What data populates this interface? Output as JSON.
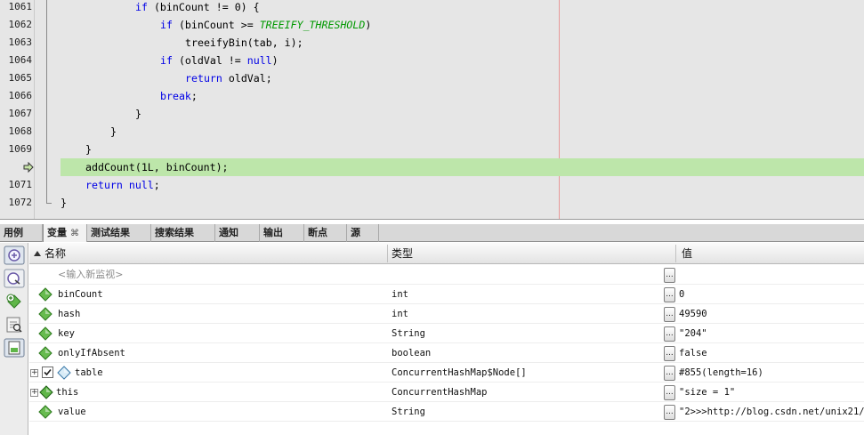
{
  "editor": {
    "lines": [
      {
        "no": "1061",
        "indent": 8,
        "segments": [
          {
            "t": "if",
            "k": "kw"
          },
          {
            "t": " (binCount != 0) {"
          }
        ]
      },
      {
        "no": "1062",
        "indent": 12,
        "segments": [
          {
            "t": "if",
            "k": "kw"
          },
          {
            "t": " (binCount >= "
          },
          {
            "t": "TREEIFY_THRESHOLD",
            "k": "const"
          },
          {
            "t": ")"
          }
        ]
      },
      {
        "no": "1063",
        "indent": 16,
        "segments": [
          {
            "t": "treeifyBin(tab, i);"
          }
        ]
      },
      {
        "no": "1064",
        "indent": 12,
        "segments": [
          {
            "t": "if",
            "k": "kw"
          },
          {
            "t": " (oldVal != "
          },
          {
            "t": "null",
            "k": "kw"
          },
          {
            "t": ")"
          }
        ]
      },
      {
        "no": "1065",
        "indent": 16,
        "segments": [
          {
            "t": "return",
            "k": "kw"
          },
          {
            "t": " oldVal;"
          }
        ]
      },
      {
        "no": "1066",
        "indent": 12,
        "segments": [
          {
            "t": "break",
            "k": "kw"
          },
          {
            "t": ";"
          }
        ]
      },
      {
        "no": "1067",
        "indent": 8,
        "segments": [
          {
            "t": "}"
          }
        ]
      },
      {
        "no": "1068",
        "indent": 4,
        "segments": [
          {
            "t": "}"
          }
        ]
      },
      {
        "no": "1069",
        "indent": 0,
        "segments": [
          {
            "t": "}"
          }
        ]
      },
      {
        "no": "",
        "indent": 0,
        "current": true,
        "segments": [
          {
            "t": "addCount(1L, binCount);"
          }
        ]
      },
      {
        "no": "1071",
        "indent": 0,
        "segments": [
          {
            "t": "return",
            "k": "kw"
          },
          {
            "t": " "
          },
          {
            "t": "null",
            "k": "kw"
          },
          {
            "t": ";"
          }
        ]
      },
      {
        "no": "1072",
        "indent": -4,
        "segments": [
          {
            "t": "}"
          }
        ]
      }
    ]
  },
  "tabs": [
    {
      "label": "用例",
      "name": "tab-usages"
    },
    {
      "label": "变量",
      "name": "tab-variables",
      "active": true,
      "close": "⌘"
    },
    {
      "label": "测试结果",
      "name": "tab-test-results"
    },
    {
      "label": "搜索结果",
      "name": "tab-search-results"
    },
    {
      "label": "通知",
      "name": "tab-notifications"
    },
    {
      "label": "输出",
      "name": "tab-output"
    },
    {
      "label": "断点",
      "name": "tab-breakpoints"
    },
    {
      "label": "源",
      "name": "tab-sources"
    }
  ],
  "variables": {
    "headers": {
      "name": "名称",
      "type": "类型",
      "value": "值"
    },
    "new_watch_placeholder": "<输入新监视>",
    "rows": [
      {
        "name": "binCount",
        "type": "int",
        "value": "0",
        "icon": "field-icon"
      },
      {
        "name": "hash",
        "type": "int",
        "value": "49590",
        "icon": "field-icon"
      },
      {
        "name": "key",
        "type": "String",
        "value": "\"204\"",
        "icon": "field-icon"
      },
      {
        "name": "onlyIfAbsent",
        "type": "boolean",
        "value": "false",
        "icon": "field-icon"
      },
      {
        "name": "table",
        "type": "ConcurrentHashMap$Node[]",
        "value": "#855(length=16)",
        "icon": "array-icon",
        "expandable": true,
        "checkbox": true
      },
      {
        "name": "this",
        "type": "ConcurrentHashMap",
        "value": "\"size = 1\"",
        "icon": "object-icon",
        "expandable": true
      },
      {
        "name": "value",
        "type": "String",
        "value": "\"2>>>http://blog.csdn.net/unix21/\"",
        "icon": "field-icon"
      }
    ],
    "ellipsis_label": "..."
  },
  "colors": {
    "editor_bg": "#e6e6e6",
    "current_line": "#bde6aa",
    "keyword": "#0000e6",
    "constant": "#009900",
    "margin_line": "#e79a9a"
  }
}
